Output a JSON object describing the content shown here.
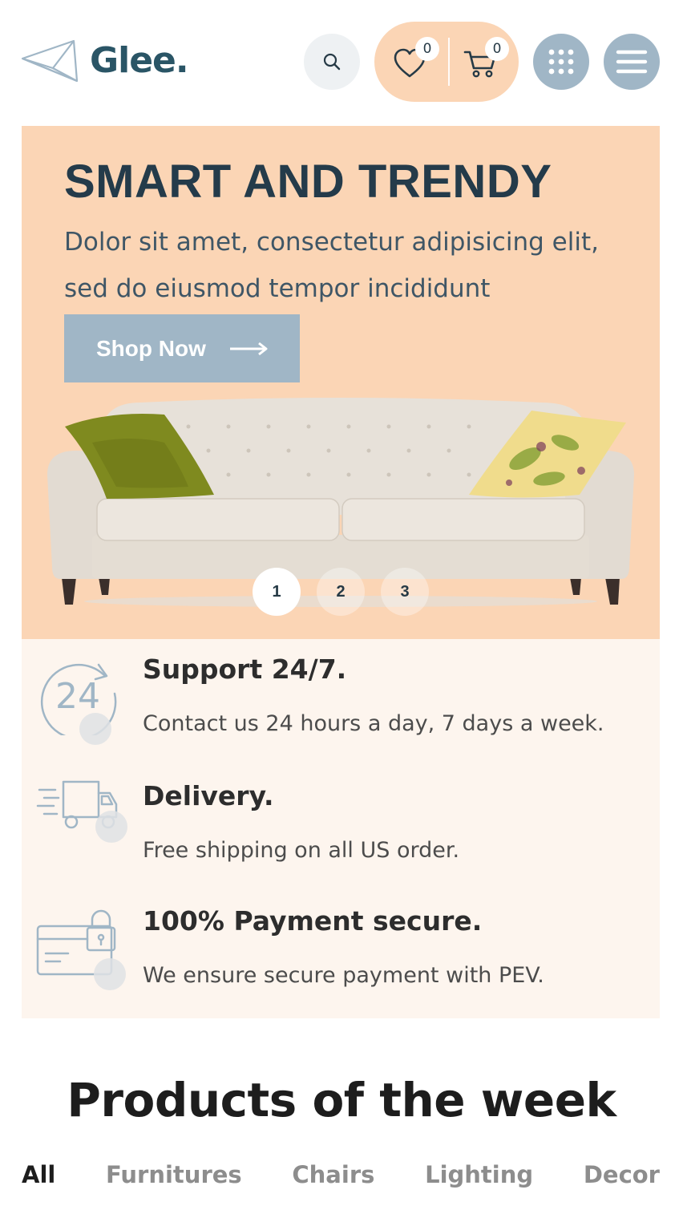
{
  "header": {
    "logo_text": "Glee.",
    "wishlist_count": "0",
    "cart_count": "0"
  },
  "hero": {
    "title": "SMART AND TRENDY",
    "text": "Dolor sit amet, consectetur adipisicing elit, sed do eiusmod tempor incididunt",
    "button_label": "Shop Now",
    "slides": [
      "1",
      "2",
      "3"
    ],
    "active_slide": 1
  },
  "features": [
    {
      "icon": "support-24-icon",
      "title": "Support 24/7.",
      "desc": "Contact us 24 hours a day, 7 days a week."
    },
    {
      "icon": "delivery-truck-icon",
      "title": "Delivery.",
      "desc": "Free shipping on all US order."
    },
    {
      "icon": "secure-payment-icon",
      "title": "100% Payment secure.",
      "desc": "We ensure secure payment with PEV."
    }
  ],
  "products": {
    "title": "Products of the week",
    "tabs": [
      "All",
      "Furnitures",
      "Chairs",
      "Lighting",
      "Decor"
    ],
    "active_tab": "All"
  },
  "colors": {
    "accent_peach": "#fbd5b5",
    "accent_blue": "#a0b6c6",
    "dark_navy": "#243b4a",
    "feature_bg": "#fdf5ee"
  }
}
